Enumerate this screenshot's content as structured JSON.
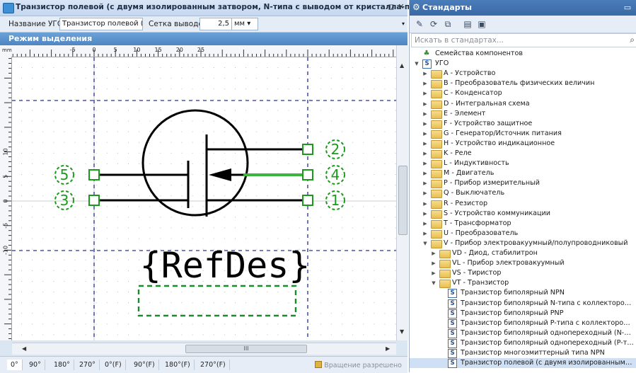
{
  "editor": {
    "title": "Транзистор полевой (с двумя изолированным затвором, N-типа с выводом от кристалла-подложки)",
    "props": {
      "name_label": "Название УГО",
      "name_value": "Транзистор полевой (с ...",
      "grid_label": "Сетка выводов",
      "grid_value": "2,5",
      "unit": "мм"
    },
    "mode": "Режим выделения",
    "ruler_unit": "mm",
    "ruler_top": [
      "-5",
      "0",
      "5",
      "10",
      "15",
      "20",
      "25"
    ],
    "ruler_left": [
      "10",
      "5",
      "0",
      "-5",
      "-10"
    ],
    "pins": [
      "5",
      "3",
      "2",
      "4",
      "1"
    ],
    "refdes": "{RefDes}",
    "rotations": [
      "0°",
      "90°",
      "180°",
      "270°",
      "0°(F)",
      "90°(F)",
      "180°(F)",
      "270°(F)"
    ],
    "status": "Вращение разрешено",
    "scroll_grip": "III",
    "pin_color": "#1a9a1a",
    "selected_pin_color": "#3db43d"
  },
  "standards": {
    "title": "Стандарты",
    "search_placeholder": "Искать в стандартах...",
    "tree": [
      {
        "label": "Семейства компонентов",
        "icon": "family",
        "level": 0,
        "toggle": ""
      },
      {
        "label": "УГО",
        "icon": "s",
        "level": 0,
        "toggle": "down"
      },
      {
        "label": "A - Устройство",
        "icon": "folder",
        "level": 1,
        "toggle": "right"
      },
      {
        "label": "B - Преобразователь физических величин",
        "icon": "folder",
        "level": 1,
        "toggle": "right"
      },
      {
        "label": "C - Конденсатор",
        "icon": "folder",
        "level": 1,
        "toggle": "right"
      },
      {
        "label": "D - Интегральная схема",
        "icon": "folder",
        "level": 1,
        "toggle": "right"
      },
      {
        "label": "E - Элемент",
        "icon": "folder",
        "level": 1,
        "toggle": "right"
      },
      {
        "label": "F - Устройство защитное",
        "icon": "folder",
        "level": 1,
        "toggle": "right"
      },
      {
        "label": "G - Генератор/Источник питания",
        "icon": "folder",
        "level": 1,
        "toggle": "right"
      },
      {
        "label": "H - Устройство индикационное",
        "icon": "folder",
        "level": 1,
        "toggle": "right"
      },
      {
        "label": "K - Реле",
        "icon": "folder",
        "level": 1,
        "toggle": "right"
      },
      {
        "label": "L - Индуктивность",
        "icon": "folder",
        "level": 1,
        "toggle": "right"
      },
      {
        "label": "M - Двигатель",
        "icon": "folder",
        "level": 1,
        "toggle": "right"
      },
      {
        "label": "P - Прибор измерительный",
        "icon": "folder",
        "level": 1,
        "toggle": "right"
      },
      {
        "label": "Q - Выключатель",
        "icon": "folder",
        "level": 1,
        "toggle": "right"
      },
      {
        "label": "R - Резистор",
        "icon": "folder",
        "level": 1,
        "toggle": "right"
      },
      {
        "label": "S - Устройство коммуникации",
        "icon": "folder",
        "level": 1,
        "toggle": "right"
      },
      {
        "label": "T - Трансформатор",
        "icon": "folder",
        "level": 1,
        "toggle": "right"
      },
      {
        "label": "U - Преобразователь",
        "icon": "folder",
        "level": 1,
        "toggle": "right"
      },
      {
        "label": "V - Прибор электровакуумный/полупроводниковый",
        "icon": "folder",
        "level": 1,
        "toggle": "down"
      },
      {
        "label": "VD - Диод, стабилитрон",
        "icon": "folder",
        "level": 2,
        "toggle": "right"
      },
      {
        "label": "VL - Прибор электровакуумный",
        "icon": "folder",
        "level": 2,
        "toggle": "right"
      },
      {
        "label": "VS - Тиристор",
        "icon": "folder",
        "level": 2,
        "toggle": "right"
      },
      {
        "label": "VT - Транзистор",
        "icon": "folder",
        "level": 2,
        "toggle": "down"
      },
      {
        "label": "Транзистор биполярный NPN",
        "icon": "s",
        "level": 3,
        "toggle": ""
      },
      {
        "label": "Транзистор биполярный N-типа с коллектором, эле...",
        "icon": "s",
        "level": 3,
        "toggle": ""
      },
      {
        "label": "Транзистор биполярный PNP",
        "icon": "s",
        "level": 3,
        "toggle": ""
      },
      {
        "label": "Транзистор биполярный P-типа с коллектором, эле...",
        "icon": "s",
        "level": 3,
        "toggle": ""
      },
      {
        "label": "Транзистор биполярный однопереходный (N-типа)",
        "icon": "s",
        "level": 3,
        "toggle": ""
      },
      {
        "label": "Транзистор биполярный однопереходный (P-типа)",
        "icon": "s",
        "level": 3,
        "toggle": ""
      },
      {
        "label": "Транзистор многоэмиттерный типа NPN",
        "icon": "s",
        "level": 3,
        "toggle": ""
      },
      {
        "label": "Транзистор полевой (с двумя изолированным затв...",
        "icon": "s",
        "level": 3,
        "toggle": "",
        "selected": true
      }
    ]
  }
}
